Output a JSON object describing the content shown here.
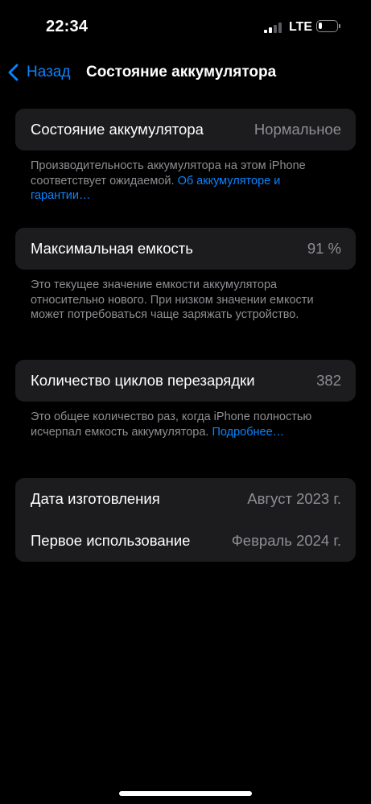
{
  "status_bar": {
    "time": "22:34",
    "network": "LTE",
    "signal_bars_total": 4,
    "signal_bars_active": 2,
    "battery_level": 0.2
  },
  "nav": {
    "back_label": "Назад",
    "title": "Состояние аккумулятора"
  },
  "battery_health": {
    "label": "Состояние аккумулятора",
    "value": "Нормальное",
    "footer_text": "Производительность аккумулятора на этом iPhone соответствует ожидаемой. ",
    "footer_link": "Об аккумуляторе и гарантии…"
  },
  "max_capacity": {
    "label": "Максимальная емкость",
    "value": "91 %",
    "footer_text": "Это текущее значение емкости аккумулятора относительно нового. При низком значении емкости может потребоваться чаще заряжать устройство."
  },
  "cycle_count": {
    "label": "Количество циклов перезарядки",
    "value": "382",
    "footer_text": "Это общее количество раз, когда iPhone полностью исчерпал емкость аккумулятора.",
    "footer_link": "Подробнее…"
  },
  "dates": {
    "manufacture_label": "Дата изготовления",
    "manufacture_value": "Август 2023 г.",
    "first_use_label": "Первое использование",
    "first_use_value": "Февраль 2024 г."
  },
  "colors": {
    "accent": "#0a84ff",
    "background": "#000000",
    "card": "#1c1c1e",
    "secondary_text": "#8e8e93"
  }
}
